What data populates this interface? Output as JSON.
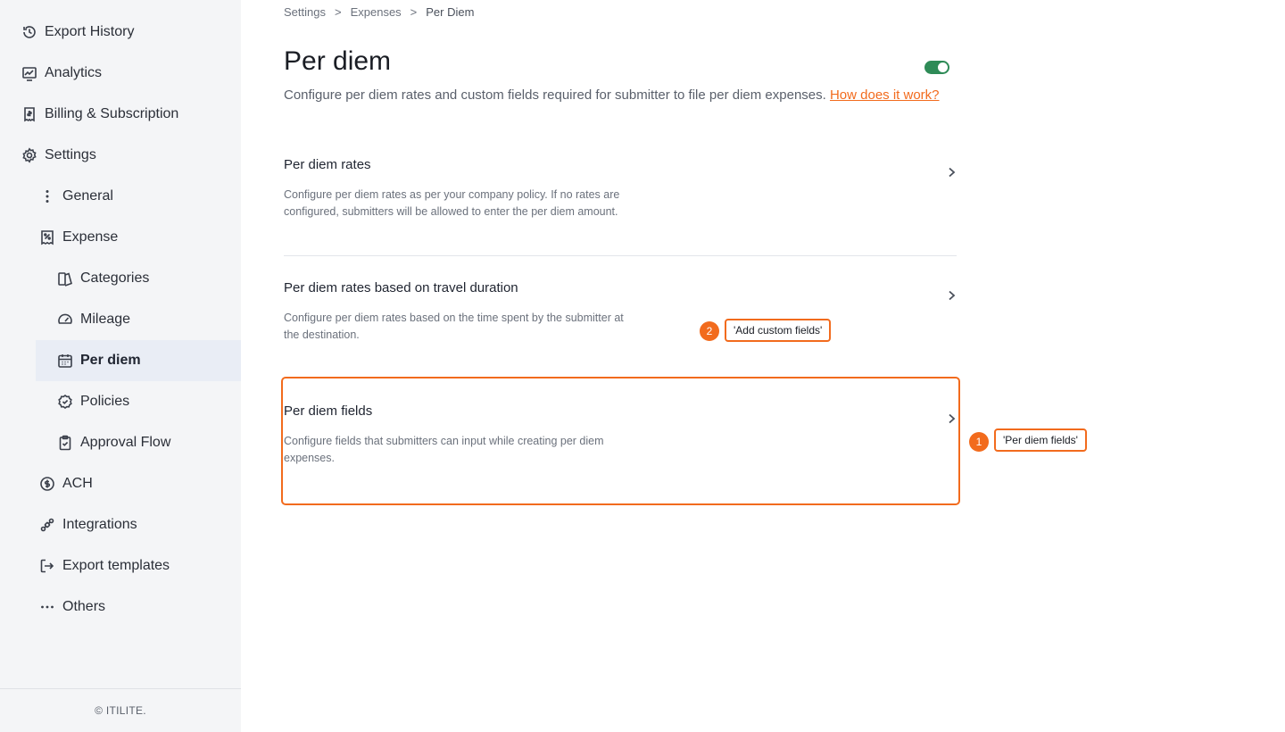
{
  "sidebar": {
    "items": [
      {
        "label": "Export History",
        "icon": "history-icon"
      },
      {
        "label": "Analytics",
        "icon": "analytics-icon"
      },
      {
        "label": "Billing & Subscription",
        "icon": "receipt-icon"
      },
      {
        "label": "Settings",
        "icon": "gear-icon"
      },
      {
        "label": "General",
        "icon": "kebab-icon"
      },
      {
        "label": "Expense",
        "icon": "expense-icon"
      },
      {
        "label": "Categories",
        "icon": "categories-icon"
      },
      {
        "label": "Mileage",
        "icon": "speedometer-icon"
      },
      {
        "label": "Per diem",
        "icon": "calendar-icon",
        "active": true
      },
      {
        "label": "Policies",
        "icon": "shield-check-icon"
      },
      {
        "label": "Approval Flow",
        "icon": "clipboard-check-icon"
      },
      {
        "label": "ACH",
        "icon": "dollar-circle-icon"
      },
      {
        "label": "Integrations",
        "icon": "integrations-icon"
      },
      {
        "label": "Export templates",
        "icon": "export-icon"
      },
      {
        "label": "Others",
        "icon": "more-icon"
      }
    ],
    "footer": "© ITILITE."
  },
  "breadcrumb": {
    "items": [
      "Settings",
      "Expenses",
      "Per Diem"
    ],
    "separator": ">"
  },
  "page": {
    "title": "Per diem",
    "toggle_on": true,
    "description": "Configure per diem rates and custom fields required for submitter to file per diem expenses.",
    "help_link": "How does it work?"
  },
  "sections": [
    {
      "title": "Per diem rates",
      "description": "Configure per diem rates as per your company policy. If no rates are configured, submitters will be allowed to enter the per diem amount."
    },
    {
      "title": "Per diem rates based on travel duration",
      "description": "Configure per diem rates based on the time spent by the submitter at the destination."
    },
    {
      "title": "Per diem fields",
      "description": "Configure fields that submitters can input while creating per diem expenses."
    }
  ],
  "annotations": [
    {
      "number": "1",
      "label": "'Per diem fields'"
    },
    {
      "number": "2",
      "label": "'Add custom fields'"
    }
  ],
  "colors": {
    "accent": "#f26b1d",
    "toggle": "#2e8b57",
    "sidebar_bg": "#f4f5f7",
    "active_bg": "#e9edf5"
  }
}
